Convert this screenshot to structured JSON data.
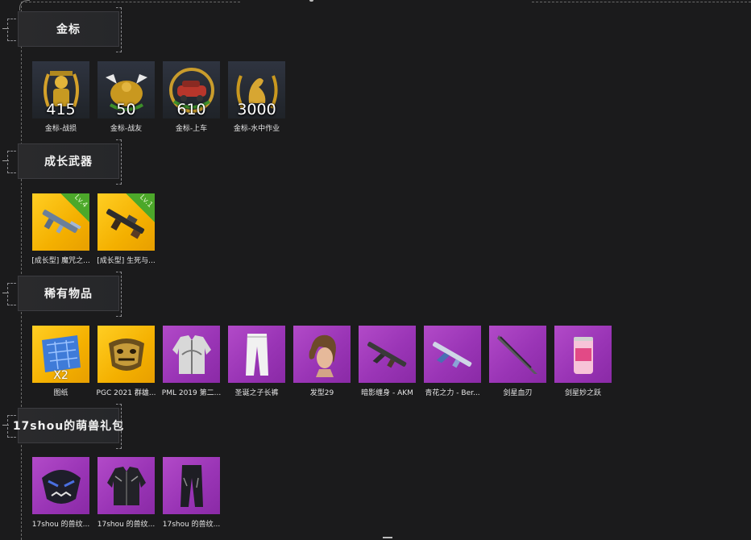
{
  "sections": [
    {
      "title": "金标",
      "items": [
        {
          "label": "金标-战损",
          "value": "415",
          "icon": "gold-soldier-emblem-icon"
        },
        {
          "label": "金标-战友",
          "value": "50",
          "icon": "gold-eagle-emblem-icon"
        },
        {
          "label": "金标-上车",
          "value": "610",
          "icon": "gold-car-emblem-icon"
        },
        {
          "label": "金标-水中作业",
          "value": "3000",
          "icon": "gold-seal-emblem-icon"
        }
      ]
    },
    {
      "title": "成长武器",
      "items": [
        {
          "label": "[成长型] 魔咒之...",
          "level": "Lv.4",
          "icon": "rifle-icon"
        },
        {
          "label": "[成长型] 生死与...",
          "level": "Lv.1",
          "icon": "machine-gun-icon"
        }
      ]
    },
    {
      "title": "稀有物品",
      "items": [
        {
          "label": "图纸",
          "qty": "X2",
          "icon": "blueprint-icon"
        },
        {
          "label": "PGC 2021 群雄...",
          "icon": "gold-mask-icon"
        },
        {
          "label": "PML 2019 第二...",
          "icon": "jacket-icon"
        },
        {
          "label": "圣诞之子长裤",
          "icon": "pants-icon"
        },
        {
          "label": "发型29",
          "icon": "hairstyle-icon"
        },
        {
          "label": "暗影缠身 - AKM",
          "icon": "akm-icon"
        },
        {
          "label": "青花之力 - Ber...",
          "icon": "rifle-skin-icon"
        },
        {
          "label": "剑星血刃",
          "icon": "blade-icon"
        },
        {
          "label": "剑星妙之跃",
          "icon": "soda-can-icon"
        }
      ]
    },
    {
      "title": "17shou的萌兽礼包",
      "items": [
        {
          "label": "17shou 的兽纹...",
          "icon": "beast-mask-icon"
        },
        {
          "label": "17shou 的兽纹...",
          "icon": "beast-jacket-icon"
        },
        {
          "label": "17shou 的兽纹...",
          "icon": "beast-pants-icon"
        }
      ]
    }
  ]
}
